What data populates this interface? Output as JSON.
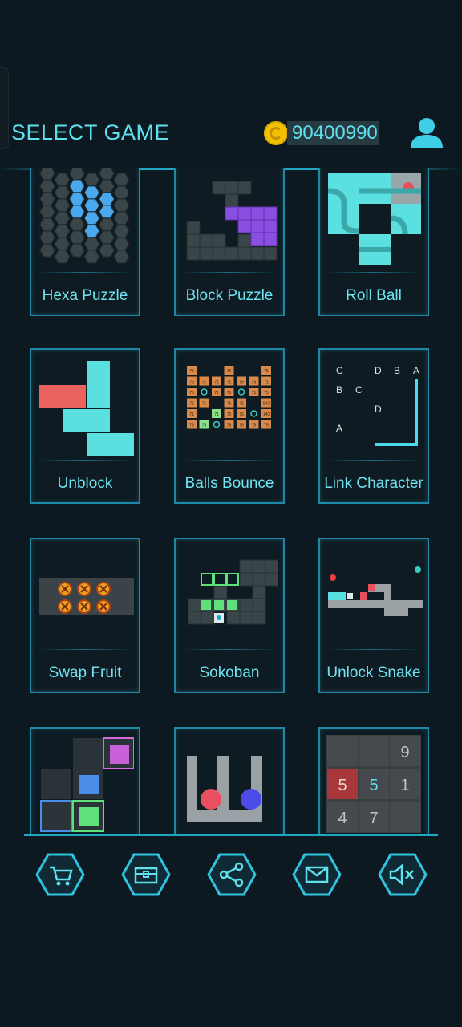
{
  "header": {
    "title": "SELECT GAME",
    "coin_count": "90400990"
  },
  "games": [
    {
      "label": "Hexa Puzzle"
    },
    {
      "label": "Block Puzzle"
    },
    {
      "label": "Roll Ball"
    },
    {
      "label": "Unblock"
    },
    {
      "label": "Balls Bounce"
    },
    {
      "label": "Link Character"
    },
    {
      "label": "Swap Fruit"
    },
    {
      "label": "Sokoban"
    },
    {
      "label": "Unlock Snake"
    }
  ],
  "link_character_letters": [
    "C",
    "D",
    "B",
    "A",
    "B",
    "C",
    "D",
    "A"
  ],
  "tiles2048": [
    "9",
    "5",
    "5",
    "1",
    "4",
    "7"
  ],
  "balls_bounce_numbers": [
    "75",
    "75",
    "75",
    "75",
    "71",
    "71",
    "71",
    "75",
    "75",
    "71",
    "75",
    "71",
    "75",
    "71",
    "75",
    "75",
    "71",
    "75",
    "75",
    "542",
    "71",
    "71",
    "75",
    "75",
    "140",
    "75",
    "75",
    "75",
    "75"
  ],
  "bottom_bar": {
    "icons": [
      "cart-icon",
      "chest-icon",
      "share-icon",
      "mail-icon",
      "mute-icon"
    ]
  },
  "colors": {
    "accent": "#5fe0ee",
    "background": "#0c1920",
    "card_border": "#1f88a6",
    "coin": "#f2c200"
  }
}
